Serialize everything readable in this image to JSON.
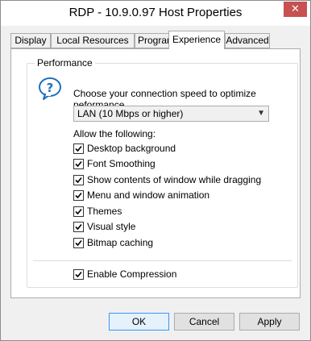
{
  "window": {
    "title": "RDP - 10.9.0.97 Host Properties",
    "close_glyph": "✕"
  },
  "tabs": [
    {
      "label": "Display"
    },
    {
      "label": "Local Resources"
    },
    {
      "label": "Programs"
    },
    {
      "label": "Experience",
      "active": true
    },
    {
      "label": "Advanced"
    }
  ],
  "performance": {
    "legend": "Performance",
    "icon": "help-question-icon",
    "prompt": "Choose your connection speed to optimize peformance.",
    "speed_value": "LAN (10 Mbps or higher)",
    "allow_label": "Allow the following:",
    "options": [
      {
        "label": "Desktop background",
        "checked": true
      },
      {
        "label": "Font Smoothing",
        "checked": true
      },
      {
        "label": "Show contents of window while dragging",
        "checked": true
      },
      {
        "label": "Menu and window animation",
        "checked": true
      },
      {
        "label": "Themes",
        "checked": true
      },
      {
        "label": "Visual style",
        "checked": true
      },
      {
        "label": "Bitmap caching",
        "checked": true
      }
    ],
    "compression": {
      "label": "Enable Compression",
      "checked": true
    }
  },
  "buttons": {
    "ok": "OK",
    "cancel": "Cancel",
    "apply": "Apply"
  },
  "colors": {
    "accent": "#3399ff",
    "close": "#c75050",
    "icon_blue": "#1e6fbf"
  }
}
